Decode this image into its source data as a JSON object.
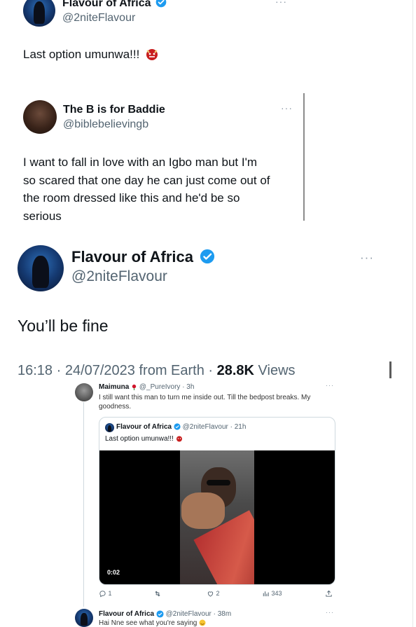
{
  "top_tweet": {
    "name": "Flavour of Africa",
    "handle": "@2niteFlavour",
    "text": "Last option umunwa!!!",
    "more": "···"
  },
  "quoted_tweet": {
    "name": "The B is for Baddie",
    "handle": "@biblebelievingb",
    "text_lines": [
      "I want to fall in love with an Igbo man but I'm",
      "so scared that one day he can just come out of",
      "the room dressed like this and he'd be so",
      "serious"
    ],
    "more": "···"
  },
  "main_tweet": {
    "name": "Flavour of Africa",
    "handle": "@2niteFlavour",
    "text": "You’ll be fine",
    "meta": "16:18 · 24/07/2023 from Earth · ",
    "views_count": "28.8K",
    "views_label": " Views",
    "more": "···"
  },
  "reply_tweet": {
    "name": "Maimuna",
    "handle": "@_PureIvory",
    "time": "· 3h",
    "text_lines": [
      "I still want this man to turn me inside out. Till the bedpost breaks. My",
      "goodness."
    ],
    "more": "···",
    "quote": {
      "name": "Flavour of Africa",
      "handle": "@2niteFlavour",
      "time": "· 21h",
      "text": "Last option umunwa!!!",
      "video_time": "0:02"
    },
    "actions": {
      "replies": "1",
      "retweets": "",
      "likes": "2",
      "views": "343"
    }
  },
  "bottom_tweet": {
    "name": "Flavour of Africa",
    "handle": "@2niteFlavour",
    "time": "· 38m",
    "text": "Hai Nne see what you're saying",
    "more": "···"
  },
  "colors": {
    "verified": "#1d9bf0",
    "text": "#0f1419",
    "muted": "#536471"
  }
}
